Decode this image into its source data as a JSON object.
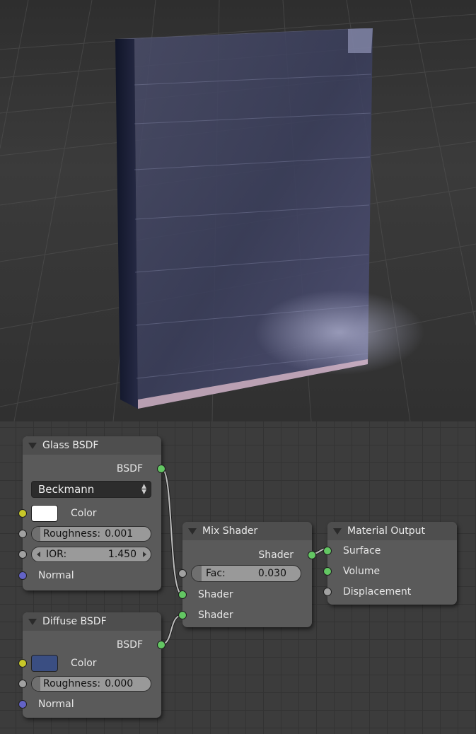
{
  "nodes": {
    "glass": {
      "title": "Glass BSDF",
      "output": "BSDF",
      "distribution": "Beckmann",
      "color_label": "Color",
      "color_value": "#ffffff",
      "roughness_label": "Roughness:",
      "roughness_value": "0.001",
      "ior_label": "IOR:",
      "ior_value": "1.450",
      "normal_label": "Normal"
    },
    "diffuse": {
      "title": "Diffuse BSDF",
      "output": "BSDF",
      "color_label": "Color",
      "color_value": "#3a4e82",
      "roughness_label": "Roughness:",
      "roughness_value": "0.000",
      "normal_label": "Normal"
    },
    "mix": {
      "title": "Mix Shader",
      "output": "Shader",
      "fac_label": "Fac:",
      "fac_value": "0.030",
      "input1": "Shader",
      "input2": "Shader"
    },
    "output": {
      "title": "Material Output",
      "surface": "Surface",
      "volume": "Volume",
      "displacement": "Displacement"
    }
  },
  "colors": {
    "socket_shader": "#63c763",
    "socket_color": "#c7c729",
    "socket_value": "#a1a1a1",
    "socket_vector": "#6363c7",
    "node_body": "#5a5a5a",
    "editor_bg": "#3c3c3c"
  }
}
